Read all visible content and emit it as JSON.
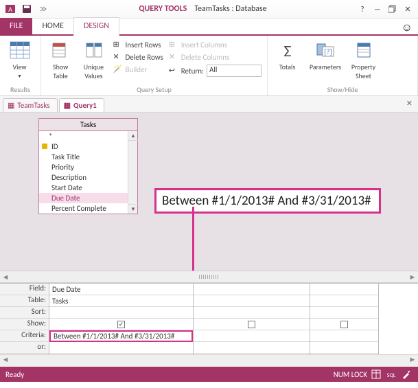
{
  "app": {
    "query_tools": "QUERY TOOLS",
    "title": "TeamTasks : Database"
  },
  "tabs": {
    "file": "FILE",
    "home": "HOME",
    "design": "DESIGN"
  },
  "ribbon": {
    "results": {
      "label": "Results",
      "view": "View"
    },
    "qsetup": {
      "label": "Query Setup",
      "show_table": "Show\nTable",
      "unique_values": "Unique\nValues",
      "insert_rows": "Insert Rows",
      "delete_rows": "Delete Rows",
      "builder": "Builder",
      "insert_cols": "Insert Columns",
      "delete_cols": "Delete Columns",
      "return": "Return:",
      "return_value": "All"
    },
    "showhide": {
      "label": "Show/Hide",
      "totals": "Totals",
      "parameters": "Parameters",
      "property": "Property\nSheet"
    }
  },
  "doctabs": {
    "t1": "TeamTasks",
    "t2": "Query1"
  },
  "tasks": {
    "title": "Tasks",
    "fields": [
      "*",
      "ID",
      "Task Title",
      "Priority",
      "Description",
      "Start Date",
      "Due Date",
      "Percent Complete"
    ]
  },
  "callout": "Between #1/1/2013# And #3/31/2013#",
  "qbe": {
    "labels": {
      "field": "Field:",
      "table": "Table:",
      "sort": "Sort:",
      "show": "Show:",
      "criteria": "Criteria:",
      "or": "or:"
    },
    "col1": {
      "field": "Due Date",
      "table": "Tasks",
      "show": true,
      "criteria": "Between #1/1/2013# And #3/31/2013#"
    },
    "col2": {
      "show": false
    },
    "col3": {
      "show": false
    }
  },
  "status": {
    "ready": "Ready",
    "numlock": "NUM LOCK"
  }
}
